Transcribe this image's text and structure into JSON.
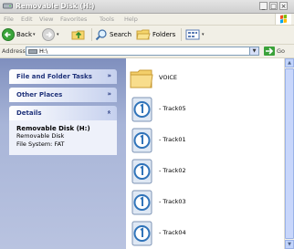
{
  "window": {
    "title": "Removable Disk (H:)",
    "controls": {
      "minimize": "_",
      "maximize": "□",
      "close": "×"
    }
  },
  "menu": [
    "File",
    "Edit",
    "View",
    "Favorites",
    "Tools",
    "Help"
  ],
  "toolbar": {
    "back_label": "Back",
    "search_label": "Search",
    "folders_label": "Folders"
  },
  "address": {
    "label": "Address",
    "value": "H:\\",
    "go_label": "Go"
  },
  "taskpane": {
    "file_folder_tasks": "File and Folder Tasks",
    "other_places": "Other Places",
    "details": {
      "title": "Details",
      "name": "Removable Disk (H:)",
      "type": "Removable Disk",
      "file_system": "File System: FAT"
    }
  },
  "files": [
    {
      "name": "VOICE",
      "kind": "folder"
    },
    {
      "name": "- Track05",
      "kind": "audio"
    },
    {
      "name": "- Track01",
      "kind": "audio"
    },
    {
      "name": "- Track02",
      "kind": "audio"
    },
    {
      "name": "- Track03",
      "kind": "audio"
    },
    {
      "name": "- Track04",
      "kind": "audio"
    }
  ],
  "icons": {
    "folder": "folder-icon",
    "audio": "audio-file-icon",
    "drive": "removable-drive-icon"
  }
}
